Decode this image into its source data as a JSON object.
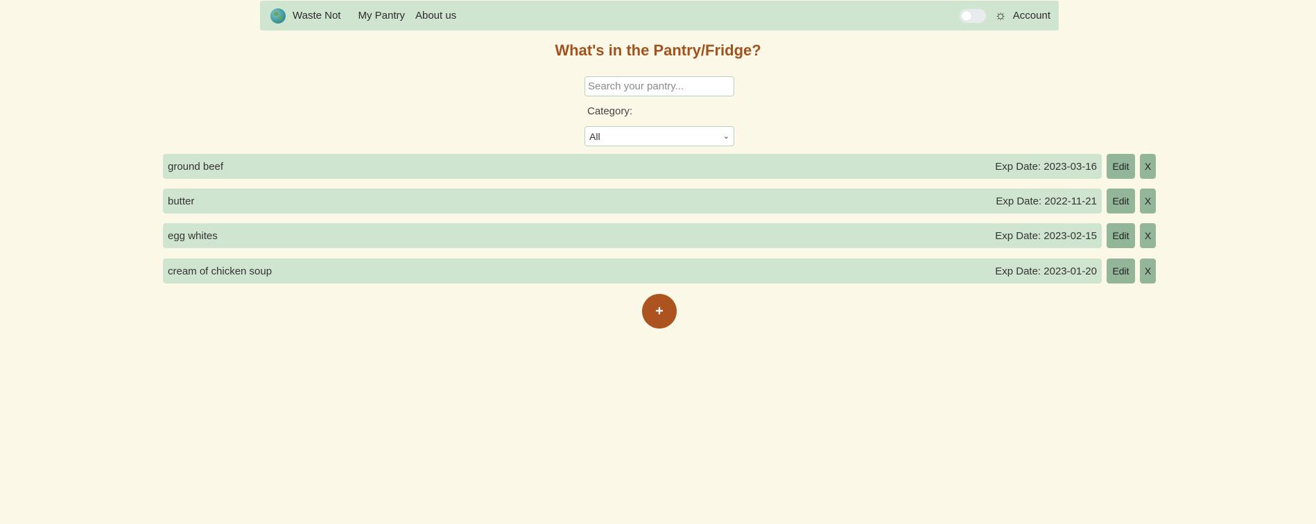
{
  "navbar": {
    "brand": "Waste Not",
    "links": [
      "My Pantry",
      "About us"
    ],
    "account": "Account",
    "icons": {
      "logo": "globe-logo-icon",
      "theme": "sun-icon"
    }
  },
  "main": {
    "title": "What's in the Pantry/Fridge?",
    "search_placeholder": "Search your pantry...",
    "category_label": "Category:",
    "category_selected": "All",
    "exp_prefix": "Exp Date:",
    "edit_label": "Edit",
    "delete_label": "X",
    "add_label": "+"
  },
  "items": [
    {
      "name": "ground beef",
      "exp": "2023-03-16"
    },
    {
      "name": "butter",
      "exp": "2022-11-21"
    },
    {
      "name": "egg whites",
      "exp": "2023-02-15"
    },
    {
      "name": "cream of chicken soup",
      "exp": "2023-01-20"
    }
  ],
  "colors": {
    "background": "#fcf8e8",
    "nav_bg": "#d0e5d0",
    "accent": "#a0531f",
    "button": "#93b59a",
    "add_button": "#ac531f"
  }
}
